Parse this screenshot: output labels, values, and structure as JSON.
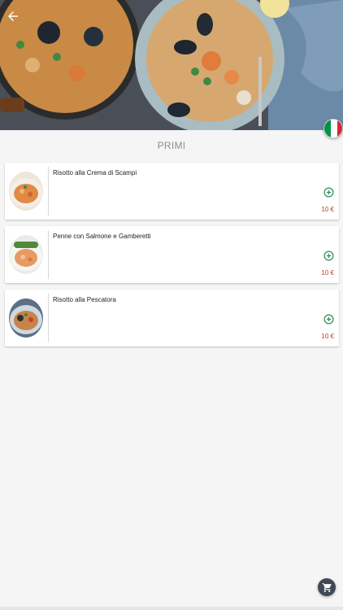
{
  "header": {
    "hero_image": "seafood-risotto-photo",
    "back_icon": "arrow-left-icon",
    "language_flag": "italy-flag-icon"
  },
  "section": {
    "title": "PRIMI"
  },
  "items": [
    {
      "name": "Risotto alla Crema di Scampi",
      "price": "10 €",
      "add_icon": "plus-circle-icon"
    },
    {
      "name": "Penne con Salmone e Gamberetti",
      "price": "10 €",
      "add_icon": "plus-circle-icon"
    },
    {
      "name": "Risotto alla Pescatora",
      "price": "10 €",
      "add_icon": "plus-circle-icon"
    }
  ],
  "cart": {
    "icon": "cart-icon"
  },
  "colors": {
    "accent_green": "#2e8b57",
    "price_red": "#c0392b",
    "fab": "#3f4a56"
  }
}
